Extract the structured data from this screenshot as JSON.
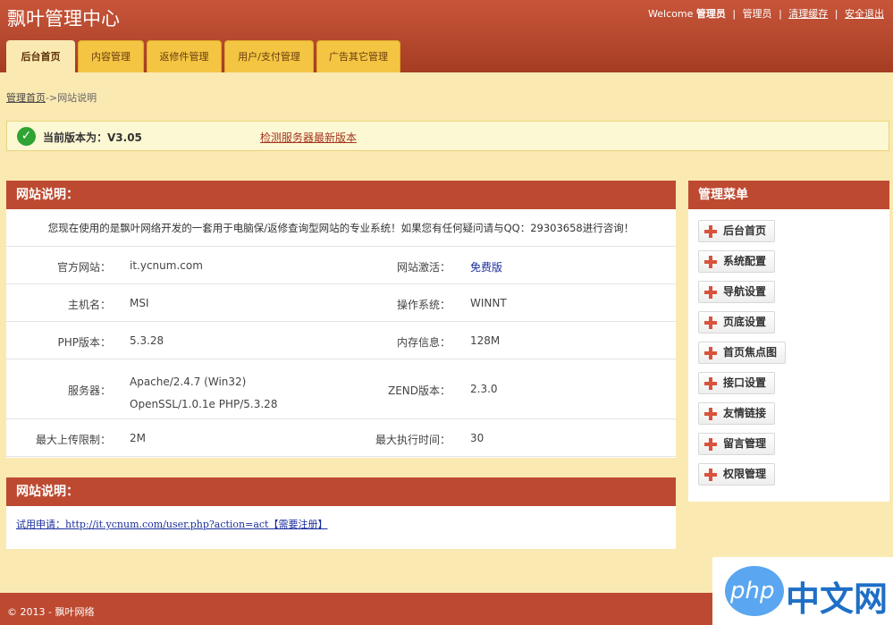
{
  "header": {
    "brand": "飘叶管理中心",
    "welcome": "Welcome",
    "user": "管理员",
    "user2": "管理员",
    "clear_cache": "清理缓存",
    "logout": "安全退出",
    "sep": "|"
  },
  "tabs": [
    {
      "label": "后台首页",
      "active": true
    },
    {
      "label": "内容管理"
    },
    {
      "label": "返修件管理"
    },
    {
      "label": "用户/支付管理"
    },
    {
      "label": "广告其它管理"
    }
  ],
  "breadcrumb": {
    "home": "管理首页",
    "arrow": "->",
    "current": "网站说明"
  },
  "version": {
    "text": "当前版本为：V3.05",
    "check_link": "检测服务器最新版本"
  },
  "info": {
    "title": "网站说明：",
    "intro": "您现在使用的是飘叶网络开发的一套用于电脑保/返修查询型网站的专业系统！如果您有任何疑问请与QQ：29303658进行咨询！",
    "rows": [
      {
        "l1": "官方网站：",
        "v1": "it.ycnum.com",
        "l2": "网站激活：",
        "v2": "免费版"
      },
      {
        "l1": "主机名：",
        "v1": "MSI",
        "l2": "操作系统：",
        "v2": "WINNT"
      },
      {
        "l1": "PHP版本：",
        "v1": "5.3.28",
        "l2": "内存信息：",
        "v2": "128M"
      },
      {
        "l1": "服务器：",
        "v1a": "Apache/2.4.7 (Win32)",
        "v1b": "OpenSSL/1.0.1e PHP/5.3.28",
        "l2": "ZEND版本：",
        "v2": "2.3.0"
      },
      {
        "l1": "最大上传限制：",
        "v1": "2M",
        "l2": "最大执行时间：",
        "v2": "30"
      }
    ]
  },
  "note": {
    "title": "网站说明：",
    "link": "试用申请：http://it.ycnum.com/user.php?action=act【需要注册】"
  },
  "menu": {
    "title": "管理菜单",
    "items": [
      "后台首页",
      "系统配置",
      "导航设置",
      "页底设置",
      "首页焦点图",
      "接口设置",
      "友情链接",
      "留言管理",
      "权限管理"
    ]
  },
  "footer": {
    "text": "© 2013 - 飘叶网络"
  },
  "watermark": {
    "php": "php",
    "cn": "中文网"
  },
  "colors": {
    "primary": "#bd4a30",
    "tab": "#f3c542",
    "background": "#fbe9b2",
    "link": "#1b2f9c"
  }
}
